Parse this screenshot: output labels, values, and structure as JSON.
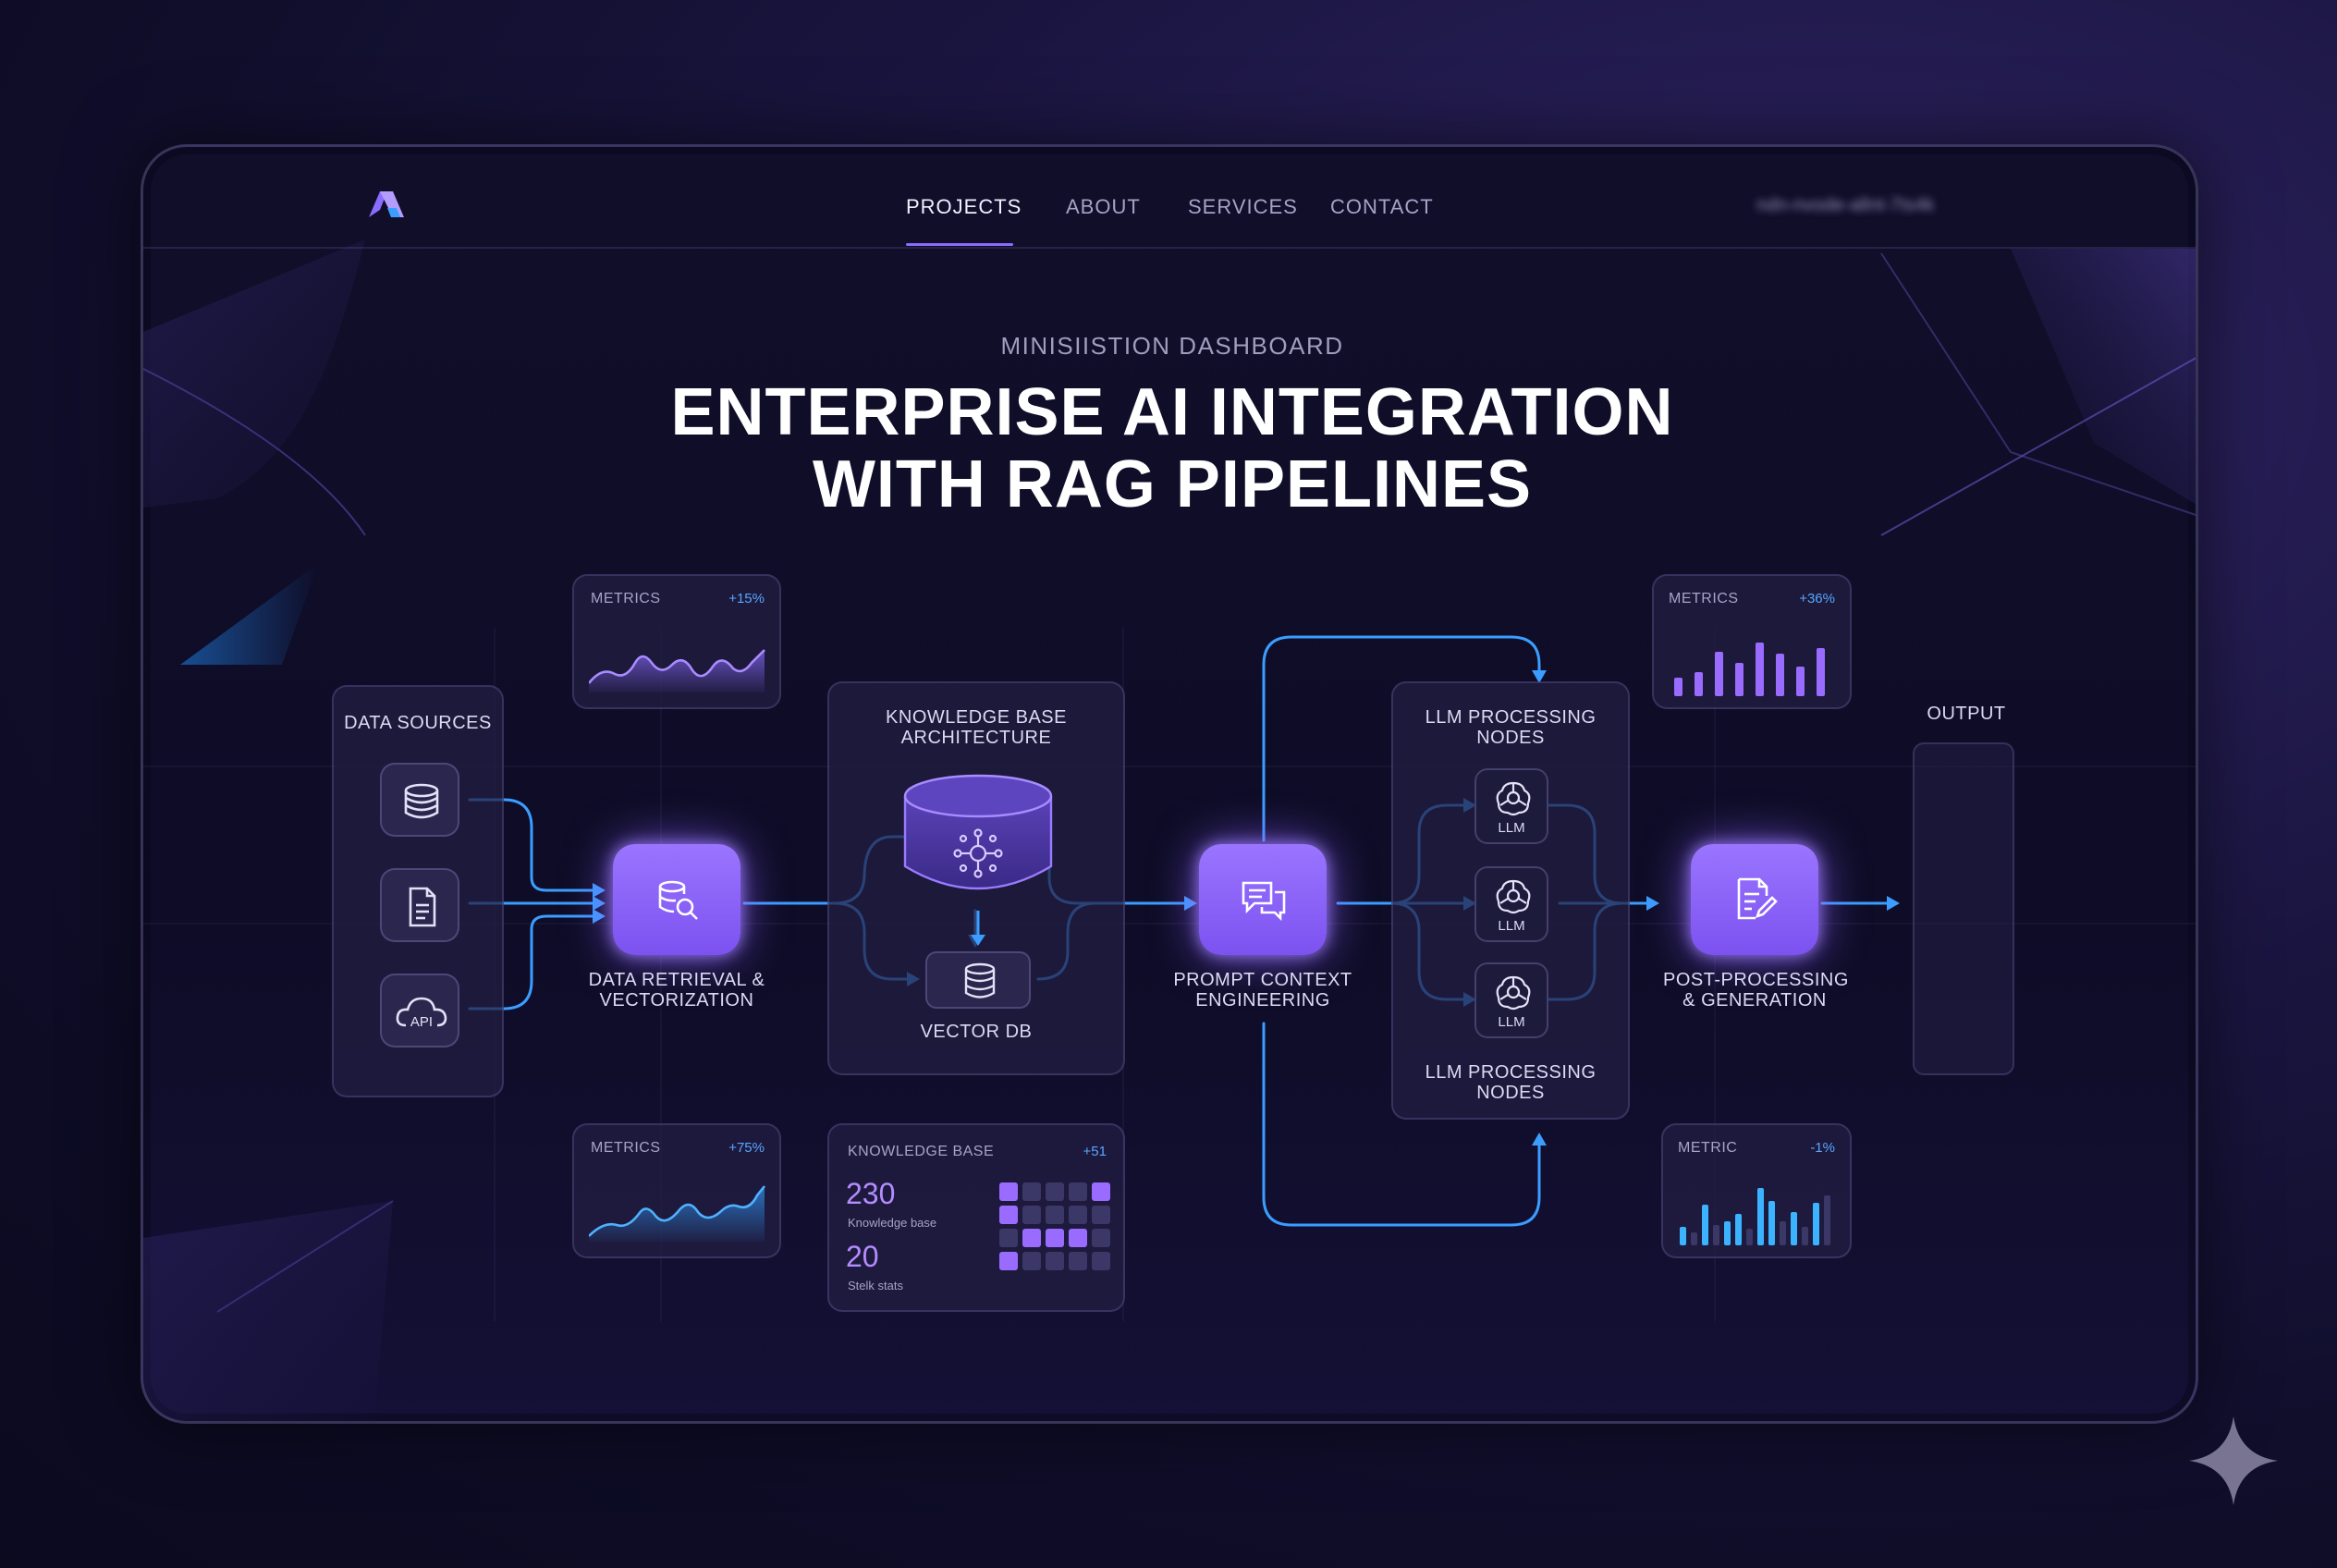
{
  "nav": {
    "items": [
      "PROJECTS",
      "ABOUT",
      "SERVICES",
      "CONTACT"
    ],
    "active": "PROJECTS",
    "blurred_text": "ndn-nvode-allnt-7ts4k"
  },
  "header": {
    "subtitle": "MINISIISTION DASHBOARD",
    "title_line1": "ENTERPRISE AI INTEGRATION",
    "title_line2": "WITH RAG PIPELINES"
  },
  "pipeline": {
    "data_sources": {
      "label": "DATA SOURCES",
      "api_label": "API"
    },
    "data_retrieval": {
      "label_line1": "DATA RETRIEVAL &",
      "label_line2": "VECTORIZATION"
    },
    "knowledge_base": {
      "label_line1": "KNOWLEDGE BASE",
      "label_line2": "ARCHITECTURE",
      "vector_db": "VECTOR DB"
    },
    "prompt": {
      "label_line1": "PROMPT CONTEXT",
      "label_line2": "ENGINEERING"
    },
    "llm": {
      "top_line1": "LLM PROCESSING",
      "top_line2": "NODES",
      "bottom_line1": "LLM PROCESSING",
      "bottom_line2": "NODES",
      "node_label": "LLM"
    },
    "post": {
      "label_line1": "POST-PROCESSING",
      "label_line2": "& GENERATION"
    },
    "output": {
      "label": "OUTPUT"
    }
  },
  "metrics": {
    "top_left": {
      "label": "METRICS",
      "value": "+15%"
    },
    "bottom_left": {
      "label": "METRICS",
      "value": "+75%"
    },
    "top_right": {
      "label": "METRICS",
      "value": "+36%"
    },
    "bottom_right": {
      "label": "METRIC",
      "value": "-1%"
    },
    "knowledge": {
      "label": "KNOWLEDGE BASE",
      "value": "+51",
      "stat1_value": "230",
      "stat1_label": "Knowledge base",
      "stat2_value": "20",
      "stat2_label": "Stelk stats"
    }
  },
  "colors": {
    "accent": "#8a6cff",
    "connector": "#3b9dff",
    "background": "#0f0d28"
  }
}
